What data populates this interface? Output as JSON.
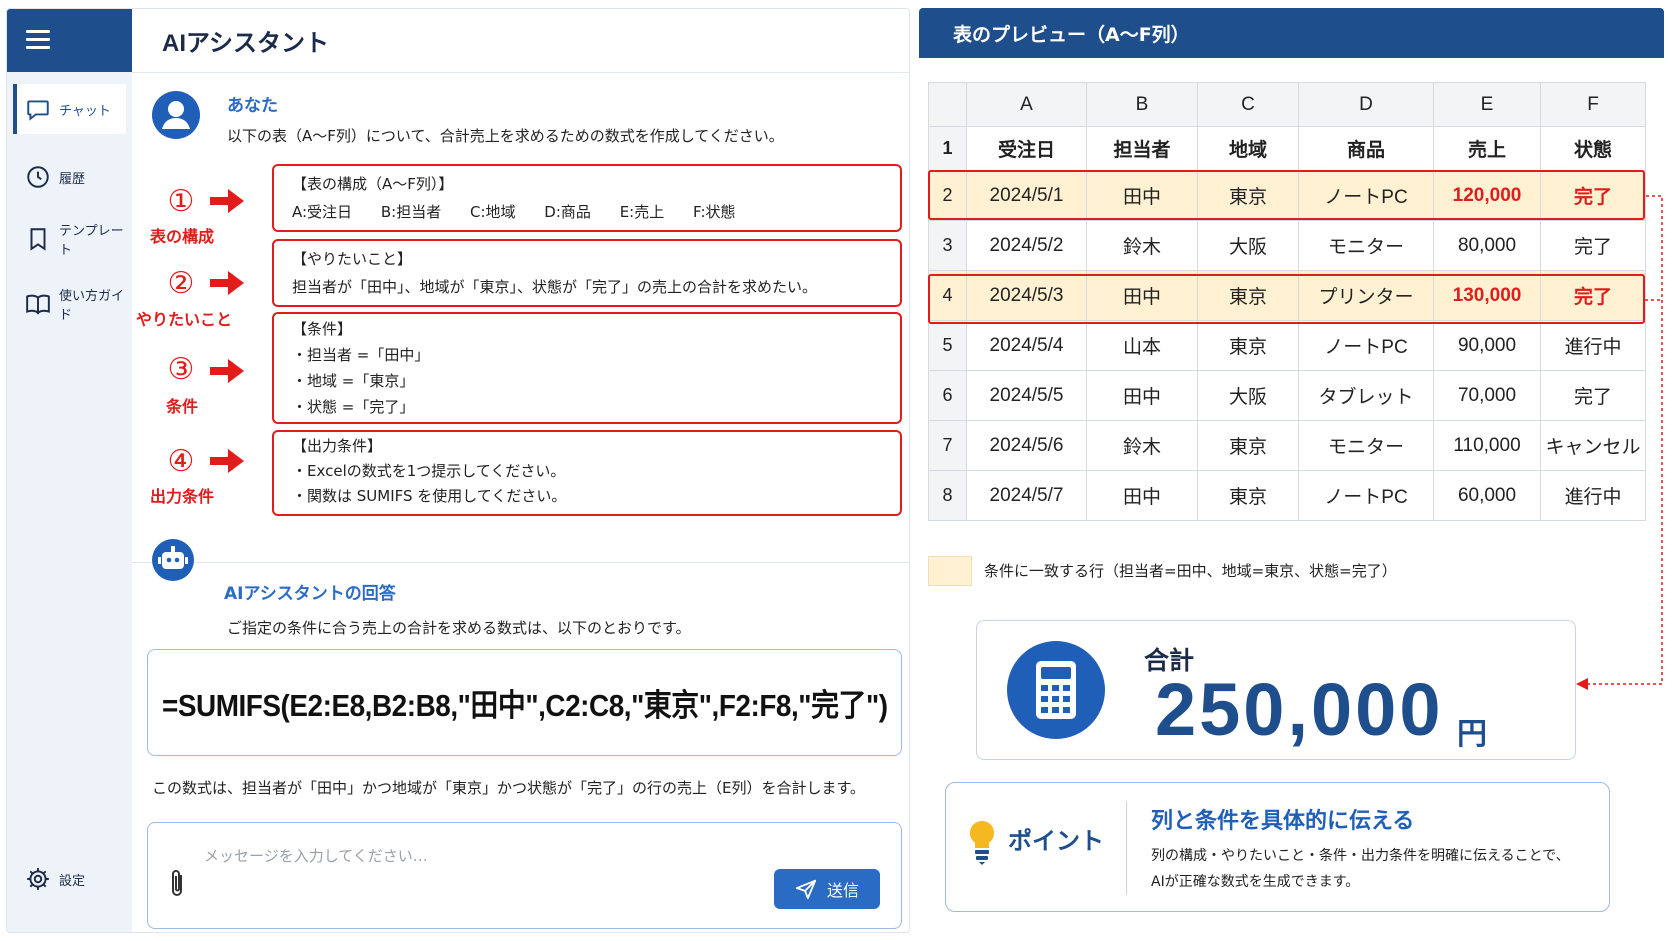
{
  "app": {
    "title": "AIアシスタント",
    "nav": [
      {
        "label": "チャット",
        "icon": "chat-icon",
        "active": true
      },
      {
        "label": "履歴",
        "icon": "clock-icon"
      },
      {
        "label": "テンプレート",
        "icon": "bookmark-icon"
      },
      {
        "label": "使い方ガイド",
        "icon": "book-icon"
      },
      {
        "label": "設定",
        "icon": "gear-icon"
      }
    ]
  },
  "user_message": {
    "sender": "あなた",
    "prompt": "以下の表（A〜F列）について、合計売上を求めるための数式を作成してください。",
    "steps": [
      {
        "marker": "①",
        "label": "表の構成"
      },
      {
        "marker": "②",
        "label": "やりたいこと"
      },
      {
        "marker": "③",
        "label": "条件"
      },
      {
        "marker": "④",
        "label": "出力条件"
      }
    ],
    "boxes": {
      "structure": {
        "title": "【表の構成（A〜F列）】",
        "columns": [
          "A:受注日",
          "B:担当者",
          "C:地域",
          "D:商品",
          "E:売上",
          "F:状態"
        ]
      },
      "goal": {
        "title": "【やりたいこと】",
        "text": "担当者が「田中」、地域が「東京」、状態が「完了」の売上の合計を求めたい。"
      },
      "conditions": {
        "title": "【条件】",
        "lines": [
          "・担当者 =「田中」",
          "・地域 =「東京」",
          "・状態 =「完了」"
        ]
      },
      "output": {
        "title": "【出力条件】",
        "lines": [
          "・Excelの数式を1つ提示してください。",
          "・関数は SUMIFS を使用してください。"
        ]
      }
    }
  },
  "ai_response": {
    "sender": "AIアシスタントの回答",
    "intro": "ご指定の条件に合う売上の合計を求める数式は、以下のとおりです。",
    "formula": "=SUMIFS(E2:E8,B2:B8,\"田中\",C2:C8,\"東京\",F2:F8,\"完了\")",
    "explanation": "この数式は、担当者が「田中」かつ地域が「東京」かつ状態が「完了」の行の売上（E列）を合計します。"
  },
  "input": {
    "placeholder": "メッセージを入力してください…",
    "send_label": "送信"
  },
  "preview": {
    "title": "表のプレビュー（A〜F列）",
    "column_letters": [
      "A",
      "B",
      "C",
      "D",
      "E",
      "F"
    ],
    "headers": [
      "受注日",
      "担当者",
      "地域",
      "商品",
      "売上",
      "状態"
    ],
    "rows": [
      {
        "num": "2",
        "cells": [
          "2024/5/1",
          "田中",
          "東京",
          "ノートPC",
          "120,000",
          "完了"
        ],
        "match": true
      },
      {
        "num": "3",
        "cells": [
          "2024/5/2",
          "鈴木",
          "大阪",
          "モニター",
          "80,000",
          "完了"
        ],
        "match": false
      },
      {
        "num": "4",
        "cells": [
          "2024/5/3",
          "田中",
          "東京",
          "プリンター",
          "130,000",
          "完了"
        ],
        "match": true
      },
      {
        "num": "5",
        "cells": [
          "2024/5/4",
          "山本",
          "東京",
          "ノートPC",
          "90,000",
          "進行中"
        ],
        "match": false
      },
      {
        "num": "6",
        "cells": [
          "2024/5/5",
          "田中",
          "大阪",
          "タブレット",
          "70,000",
          "完了"
        ],
        "match": false
      },
      {
        "num": "7",
        "cells": [
          "2024/5/6",
          "鈴木",
          "東京",
          "モニター",
          "110,000",
          "キャンセル"
        ],
        "match": false
      },
      {
        "num": "8",
        "cells": [
          "2024/5/7",
          "田中",
          "東京",
          "ノートPC",
          "60,000",
          "進行中"
        ],
        "match": false
      }
    ],
    "legend": "条件に一致する行（担当者=田中、地域=東京、状態=完了）"
  },
  "total": {
    "label": "合計",
    "value": "250,000",
    "unit": "円"
  },
  "point": {
    "label": "ポイント",
    "title": "列と条件を具体的に伝える",
    "desc": [
      "列の構成・やりたいこと・条件・出力条件を明確に伝えることで、",
      "AIが正確な数式を生成できます。"
    ]
  },
  "colors": {
    "brand": "#1f4e8c",
    "accent": "#2a6bc4",
    "highlight_row": "#fff1d1",
    "alert_red": "#e21b1b"
  }
}
